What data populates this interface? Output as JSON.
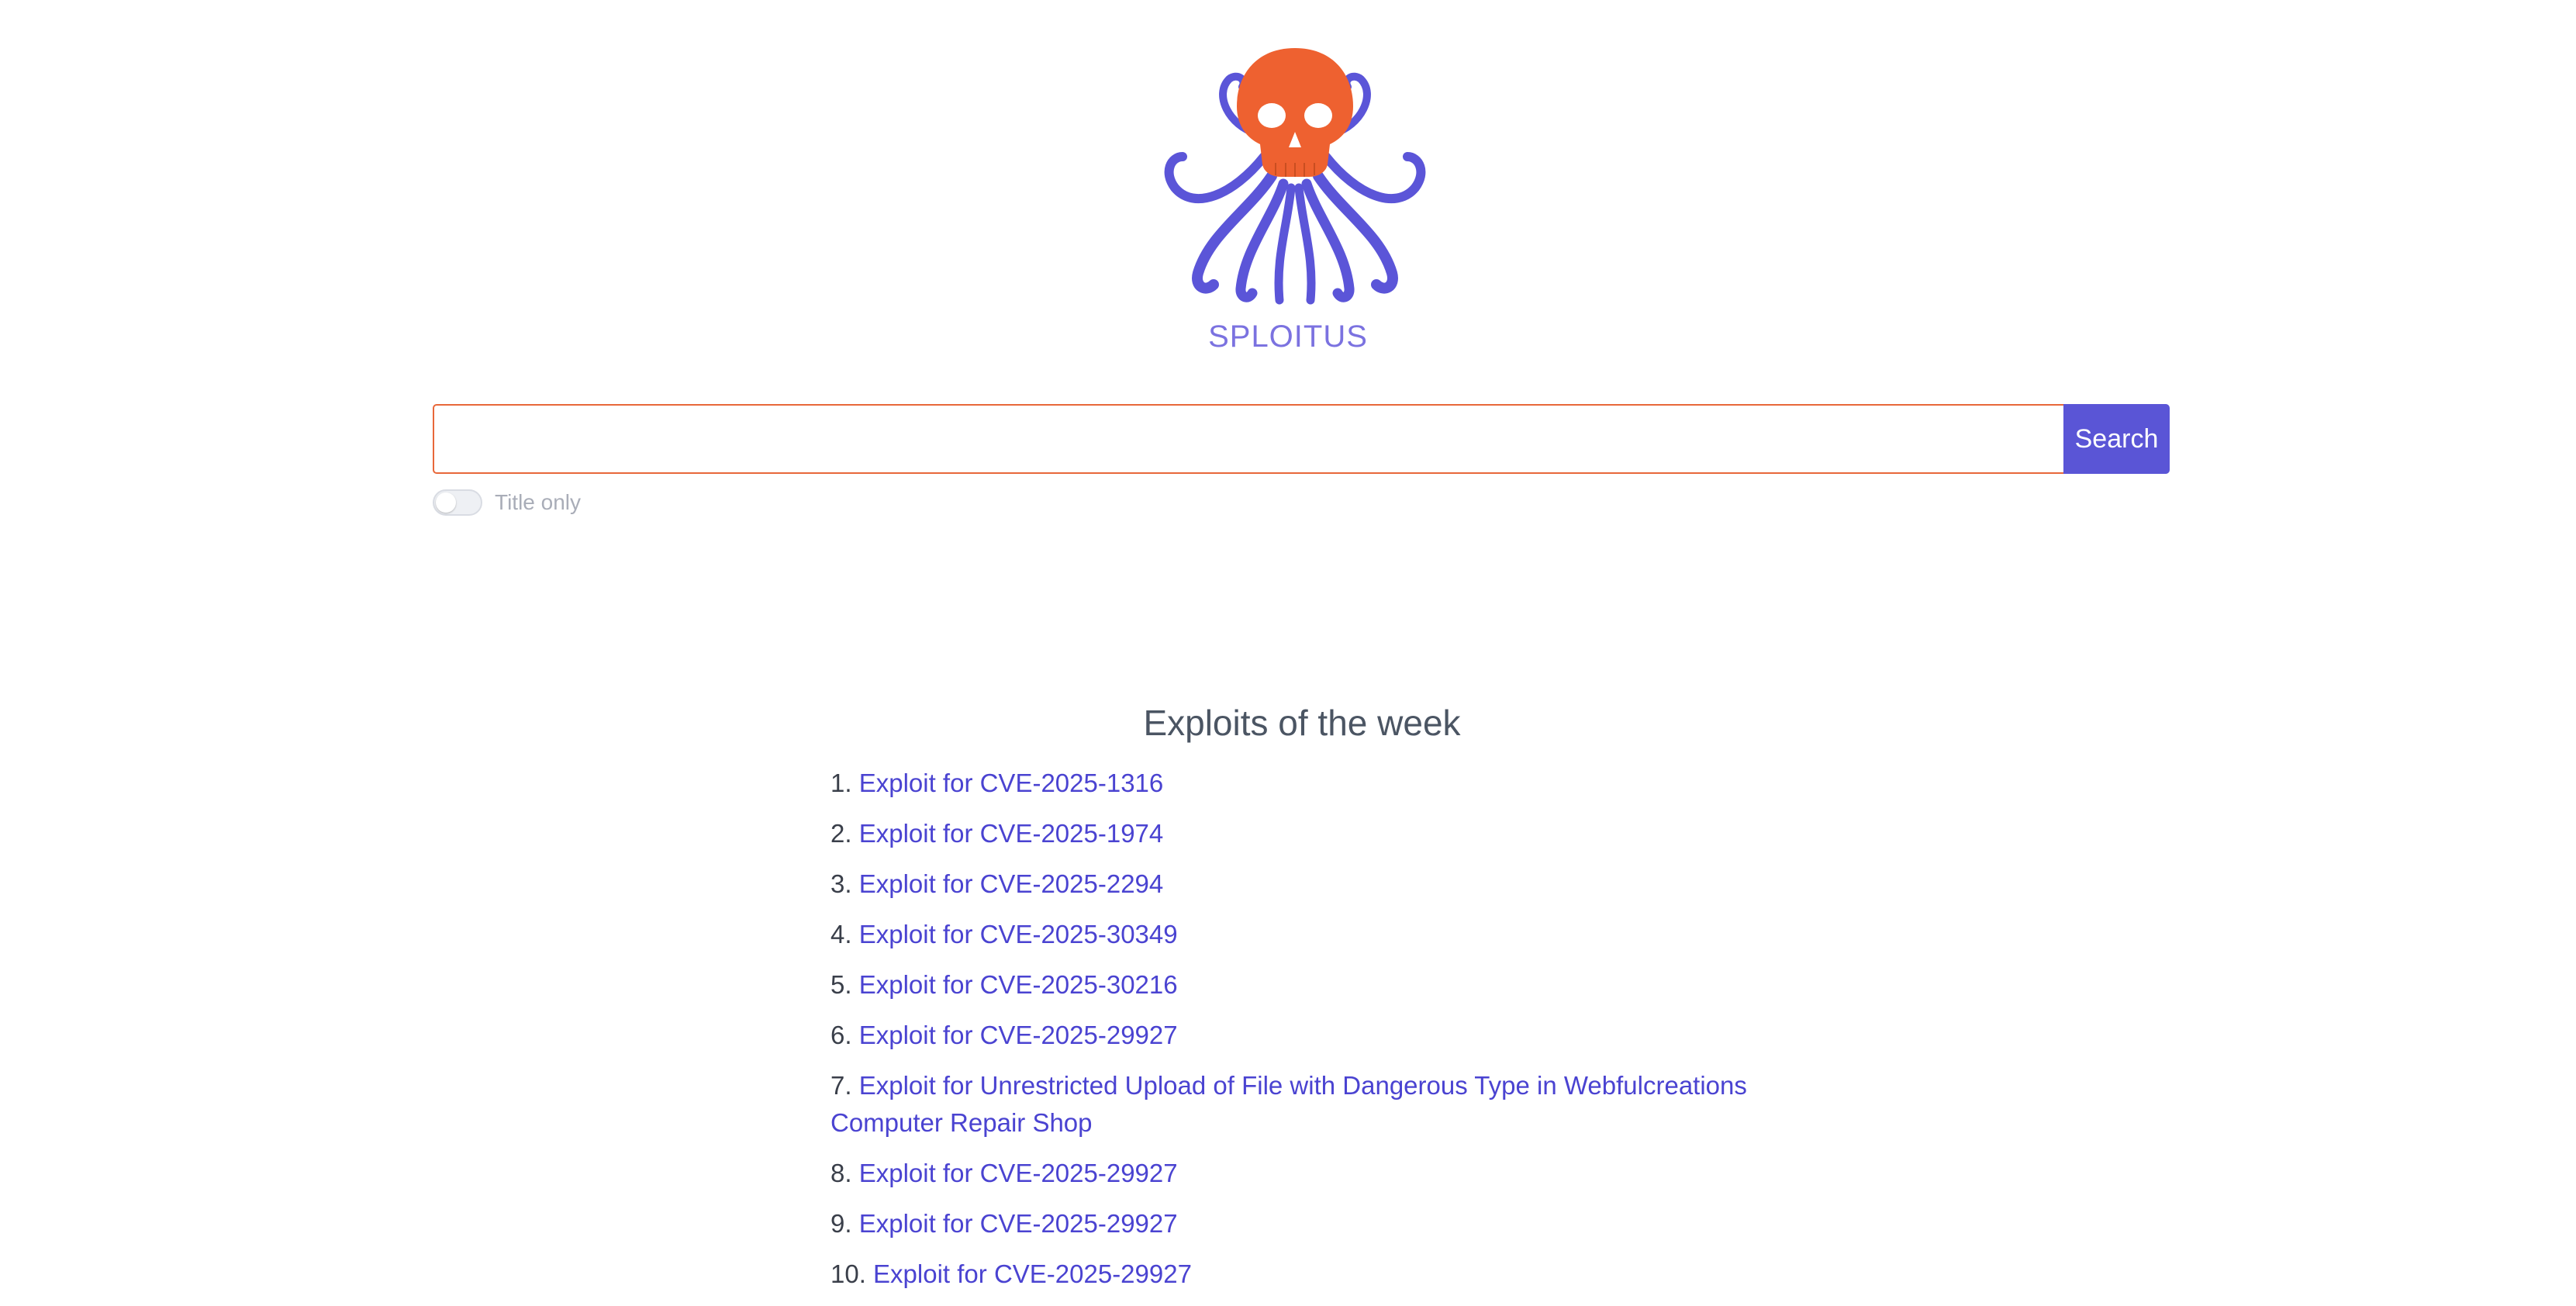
{
  "brand": {
    "name": "SPLOITUS",
    "logo_icon": "octopus-skull-icon",
    "colors": {
      "skull": "#ee6130",
      "tentacles": "#5b55d8",
      "brand_text": "#7b72e0"
    }
  },
  "search": {
    "value": "",
    "button_label": "Search",
    "accent": "#5a55d6",
    "border": "#e8683a"
  },
  "filter": {
    "title_only_label": "Title only",
    "title_only_enabled": false
  },
  "exploits": {
    "heading": "Exploits of the week",
    "items": [
      {
        "num": "1.",
        "label": "Exploit for CVE-2025-1316"
      },
      {
        "num": "2.",
        "label": "Exploit for CVE-2025-1974"
      },
      {
        "num": "3.",
        "label": "Exploit for CVE-2025-2294"
      },
      {
        "num": "4.",
        "label": "Exploit for CVE-2025-30349"
      },
      {
        "num": "5.",
        "label": "Exploit for CVE-2025-30216"
      },
      {
        "num": "6.",
        "label": "Exploit for CVE-2025-29927"
      },
      {
        "num": "7.",
        "label": "Exploit for Unrestricted Upload of File with Dangerous Type in Webfulcreations Computer Repair Shop"
      },
      {
        "num": "8.",
        "label": "Exploit for CVE-2025-29927"
      },
      {
        "num": "9.",
        "label": "Exploit for CVE-2025-29927"
      },
      {
        "num": "10.",
        "label": "Exploit for CVE-2025-29927"
      }
    ]
  }
}
